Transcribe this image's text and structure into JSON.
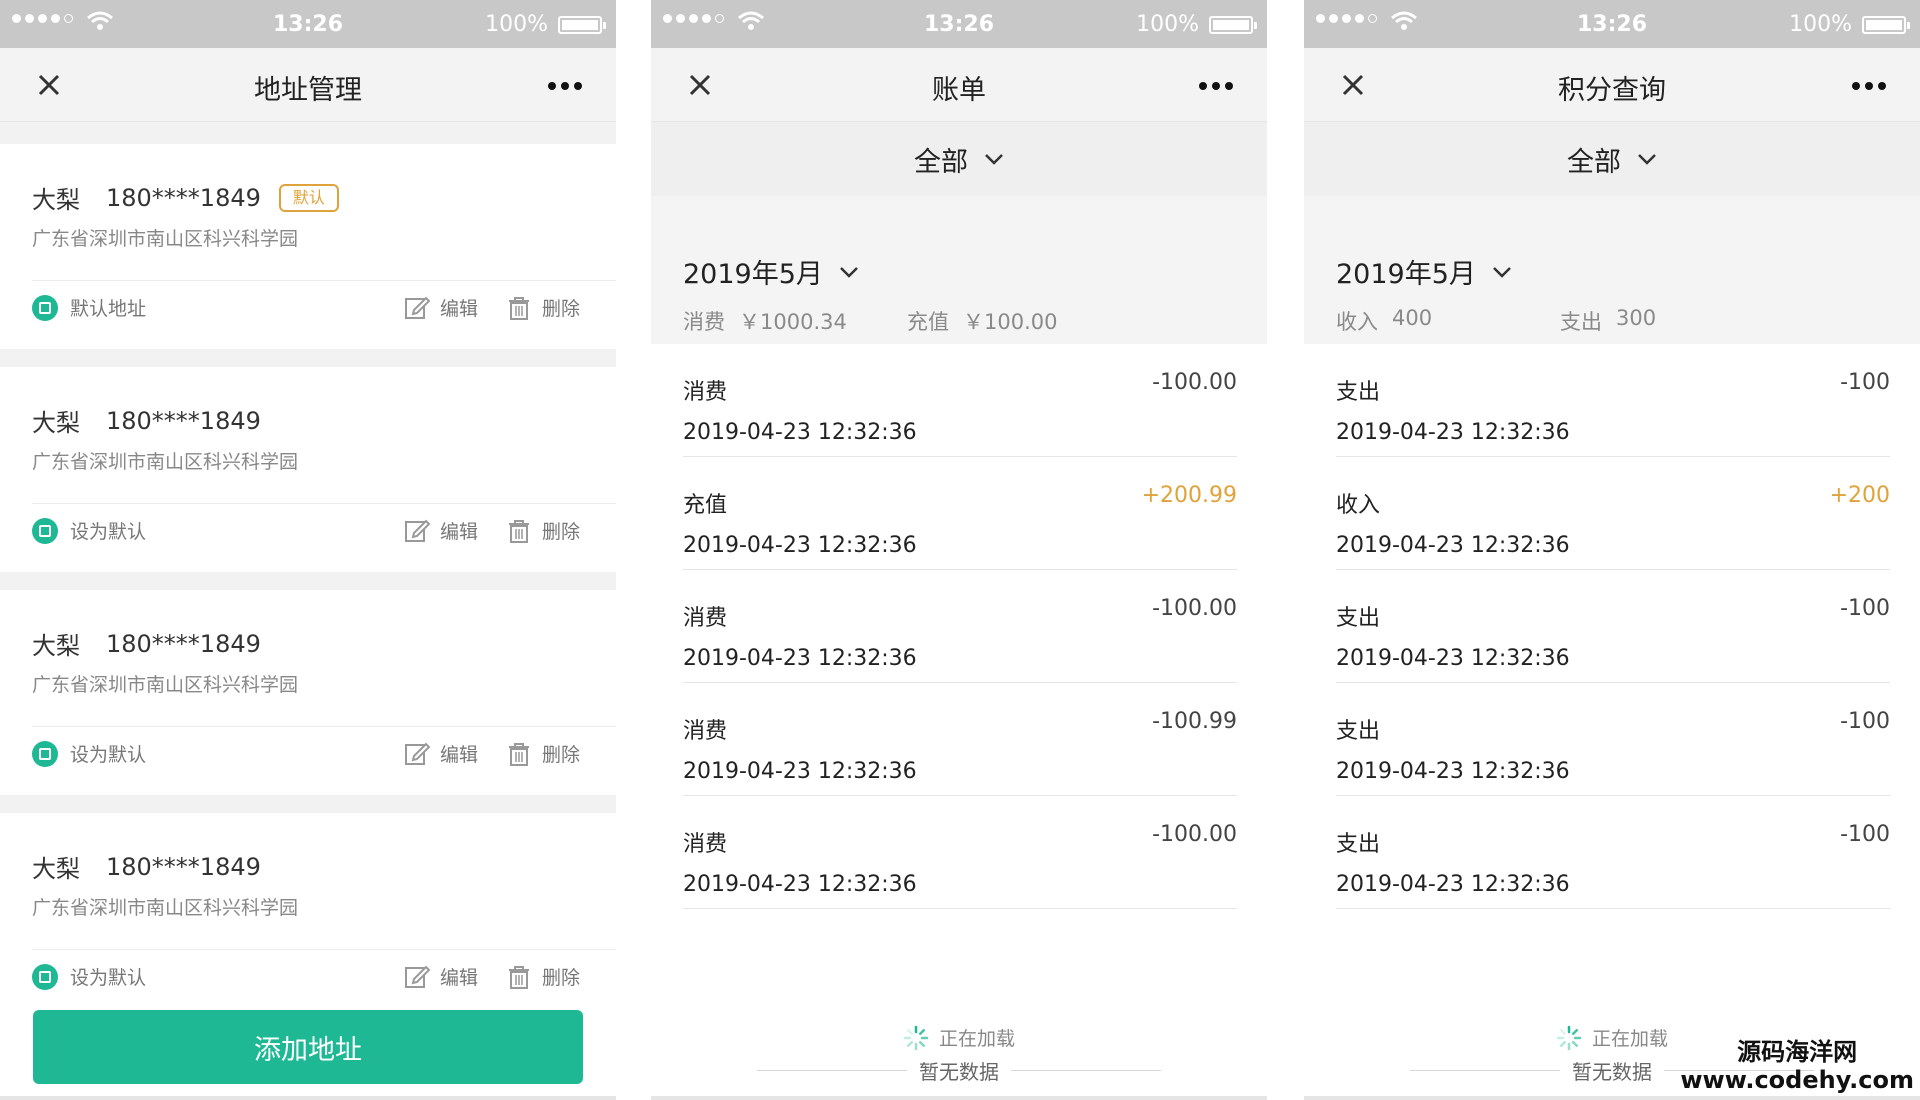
{
  "status_bar": {
    "time": "13:26",
    "battery": "100%"
  },
  "address_page": {
    "title": "地址管理",
    "cards": [
      {
        "name": "大梨",
        "phone": "180****1849",
        "badge": "默认",
        "address": "广东省深圳市南山区科兴科学园",
        "status": "默认地址"
      },
      {
        "name": "大梨",
        "phone": "180****1849",
        "address": "广东省深圳市南山区科兴科学园",
        "status": "设为默认"
      },
      {
        "name": "大梨",
        "phone": "180****1849",
        "address": "广东省深圳市南山区科兴科学园",
        "status": "设为默认"
      },
      {
        "name": "大梨",
        "phone": "180****1849",
        "address": "广东省深圳市南山区科兴科学园",
        "status": "设为默认"
      }
    ],
    "edit_label": "编辑",
    "delete_label": "删除",
    "add_button": "添加地址"
  },
  "bill_page": {
    "title": "账单",
    "filter": "全部",
    "month": "2019年5月",
    "summary": [
      {
        "label": "消费",
        "value": "￥1000.34"
      },
      {
        "label": "充值",
        "value": "￥100.00"
      }
    ],
    "records": [
      {
        "type": "消费",
        "date": "2019-04-23 12:32:36",
        "amount": "-100.00",
        "positive": false
      },
      {
        "type": "充值",
        "date": "2019-04-23 12:32:36",
        "amount": "+200.99",
        "positive": true
      },
      {
        "type": "消费",
        "date": "2019-04-23 12:32:36",
        "amount": "-100.00",
        "positive": false
      },
      {
        "type": "消费",
        "date": "2019-04-23 12:32:36",
        "amount": "-100.99",
        "positive": false
      },
      {
        "type": "消费",
        "date": "2019-04-23 12:32:36",
        "amount": "-100.00",
        "positive": false
      }
    ],
    "loading": "正在加载",
    "empty": "暂无数据"
  },
  "points_page": {
    "title": "积分查询",
    "filter": "全部",
    "month": "2019年5月",
    "summary": [
      {
        "label": "收入",
        "value": "400"
      },
      {
        "label": "支出",
        "value": "300"
      }
    ],
    "records": [
      {
        "type": "支出",
        "date": "2019-04-23 12:32:36",
        "amount": "-100",
        "positive": false
      },
      {
        "type": "收入",
        "date": "2019-04-23 12:32:36",
        "amount": "+200",
        "positive": true
      },
      {
        "type": "支出",
        "date": "2019-04-23 12:32:36",
        "amount": "-100",
        "positive": false
      },
      {
        "type": "支出",
        "date": "2019-04-23 12:32:36",
        "amount": "-100",
        "positive": false
      },
      {
        "type": "支出",
        "date": "2019-04-23 12:32:36",
        "amount": "-100",
        "positive": false
      }
    ],
    "loading": "正在加载",
    "empty": "暂无数据"
  },
  "watermark": {
    "cn": "源码海洋网",
    "url": "www.codehy.com"
  },
  "colors": {
    "accent": "#1fb894",
    "badge": "#e0a23a",
    "positive": "#e0a23a"
  },
  "icons": [
    "close-icon",
    "more-icon",
    "radio-check-icon",
    "edit-icon",
    "trash-icon",
    "chevron-down-icon",
    "spinner-icon",
    "wifi-icon",
    "battery-icon",
    "signal-icon"
  ]
}
